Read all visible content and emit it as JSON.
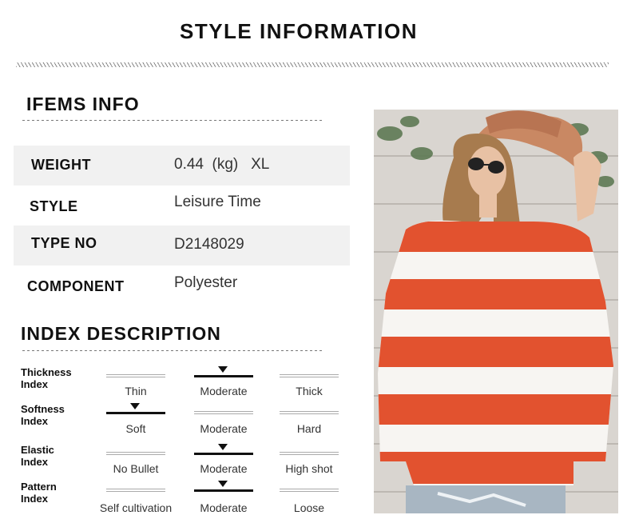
{
  "header": {
    "title": "STYLE INFORMATION"
  },
  "items_info": {
    "heading": "IFEMS INFO",
    "rows": [
      {
        "label": "WEIGHT",
        "value": "0.44  (kg)   XL"
      },
      {
        "label": "STYLE",
        "value": "Leisure Time"
      },
      {
        "label": "TYPE NO",
        "value": "D2148029"
      },
      {
        "label": "COMPONENT",
        "value": "Polyester"
      }
    ]
  },
  "index_description": {
    "heading": "INDEX DESCRIPTION",
    "rows": [
      {
        "name": "Thickness\nIndex",
        "options": [
          "Thin",
          "Moderate",
          "Thick"
        ],
        "selected": 1
      },
      {
        "name": "Softness\nIndex",
        "options": [
          "Soft",
          "Moderate",
          "Hard"
        ],
        "selected": 0
      },
      {
        "name": "Elastic\nIndex",
        "options": [
          "No Bullet",
          "Moderate",
          "High shot"
        ],
        "selected": 1
      },
      {
        "name": "Pattern\nIndex",
        "options": [
          "Self cultivation",
          "Moderate",
          "Loose"
        ],
        "selected": 1
      }
    ]
  },
  "product_image": {
    "stripe_colors": [
      "#e2522f",
      "#f7f5f2"
    ],
    "accent_color": "#e2522f"
  }
}
